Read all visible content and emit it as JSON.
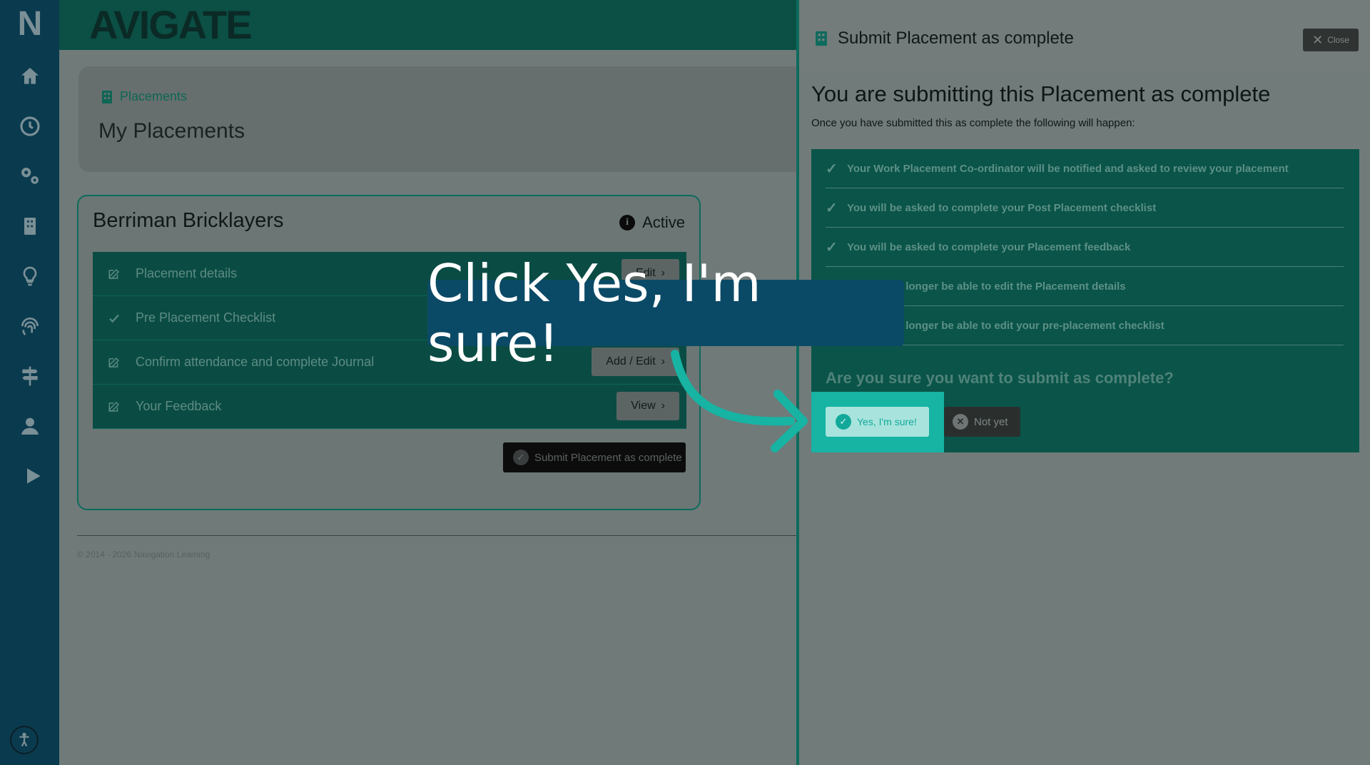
{
  "brand": "AVIGATE",
  "logo_letter": "N",
  "nav_icons": [
    "home-icon",
    "clock-icon",
    "gears-icon",
    "building-icon",
    "lightbulb-icon",
    "fingerprint-icon",
    "signpost-icon",
    "user-icon",
    "play-icon"
  ],
  "breadcrumb": "Placements",
  "page_title": "My Placements",
  "placement": {
    "company": "Berriman Bricklayers",
    "status": "Active",
    "rows": [
      {
        "label": "Placement details",
        "button": "Edit"
      },
      {
        "label": "Pre Placement Checklist",
        "button": ""
      },
      {
        "label": "Confirm attendance and complete Journal",
        "button": "Add / Edit"
      },
      {
        "label": "Your Feedback",
        "button": "View"
      }
    ],
    "submit_label": "Submit Placement as complete"
  },
  "footer": "© 2014 - 2026 Navigation Learning",
  "panel": {
    "title": "Submit Placement as complete",
    "close_label": "Close",
    "heading": "You are submitting this Placement as complete",
    "subheading": "Once you have submitted this as complete the following will happen:",
    "items": [
      "Your Work Placement Co-ordinator will be notified and asked to review your placement",
      "You will be asked to complete your Post Placement checklist",
      "You will be asked to complete your Placement feedback",
      "You will no longer be able to edit the Placement details",
      "You will no longer be able to edit your pre-placement checklist"
    ],
    "question": "Are you sure you want to submit as complete?",
    "yes_label": "Yes, I'm sure!",
    "no_label": "Not yet"
  },
  "callout_text": "Click Yes, I'm sure!",
  "colors": {
    "teal": "#0a5449",
    "highlight": "#17b3a3",
    "callout": "#0b4a66"
  }
}
